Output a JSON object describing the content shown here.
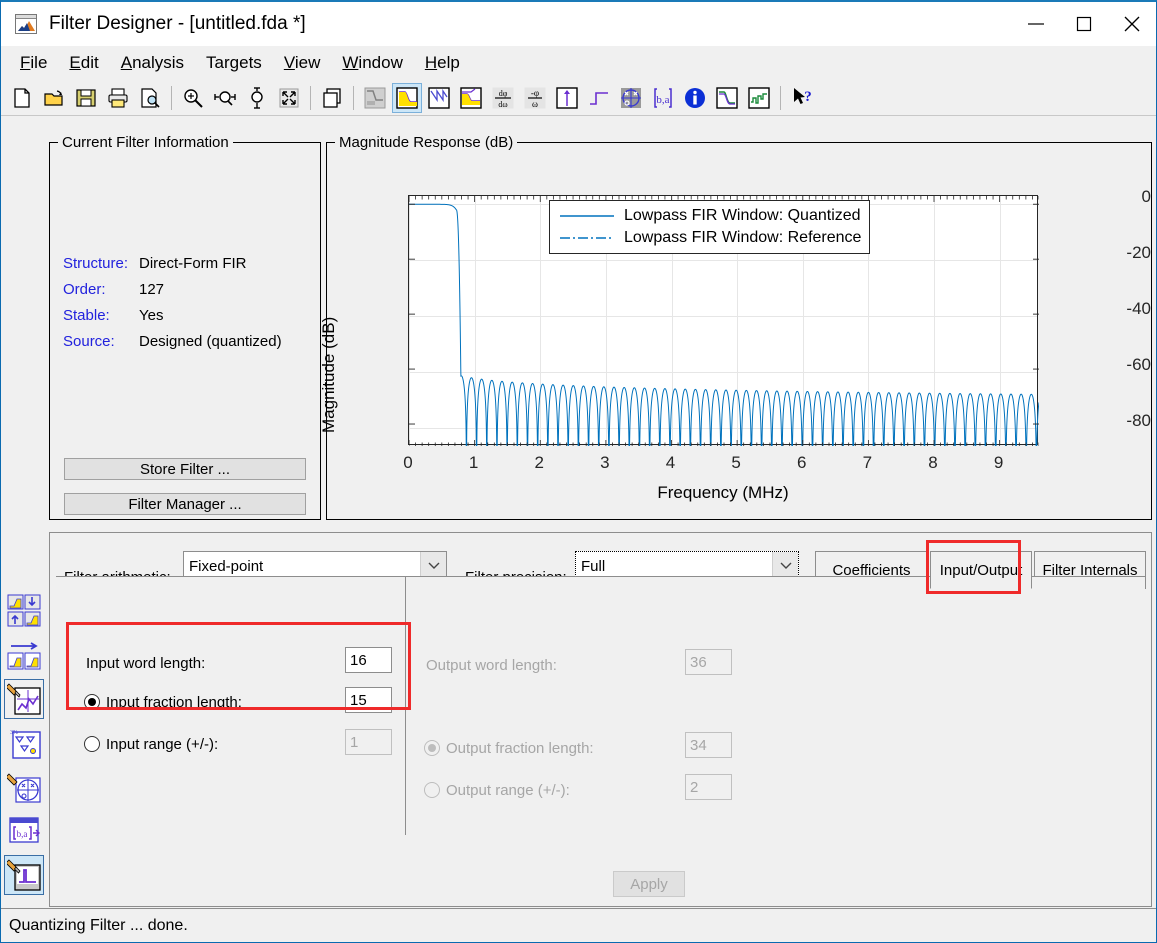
{
  "window": {
    "title": "Filter Designer -  [untitled.fda *]",
    "app_icon": "matlab-filter-icon",
    "minimize": "minimize-icon",
    "maximize": "maximize-icon",
    "close": "close-icon"
  },
  "menu": [
    {
      "label": "File",
      "mnemonic": "F"
    },
    {
      "label": "Edit",
      "mnemonic": "E"
    },
    {
      "label": "Analysis",
      "mnemonic": "A"
    },
    {
      "label": "Targets",
      "mnemonic": "g"
    },
    {
      "label": "View",
      "mnemonic": "V"
    },
    {
      "label": "Window",
      "mnemonic": "W"
    },
    {
      "label": "Help",
      "mnemonic": "H"
    }
  ],
  "toolbar": [
    {
      "name": "new-file-icon",
      "group": 0
    },
    {
      "name": "open-file-icon",
      "group": 0
    },
    {
      "name": "save-icon",
      "group": 0
    },
    {
      "name": "print-icon",
      "group": 0
    },
    {
      "name": "print-preview-icon",
      "group": 0
    },
    {
      "name": "zoom-in-icon",
      "group": 1
    },
    {
      "name": "zoom-x-icon",
      "group": 1
    },
    {
      "name": "zoom-y-icon",
      "group": 1
    },
    {
      "name": "full-view-icon",
      "group": 1
    },
    {
      "name": "copy-figure-icon",
      "group": 2
    },
    {
      "name": "filter-specifications-icon",
      "group": 3
    },
    {
      "name": "magnitude-response-icon",
      "group": 3,
      "selected": true
    },
    {
      "name": "phase-response-icon",
      "group": 3
    },
    {
      "name": "magnitude-phase-icon",
      "group": 3
    },
    {
      "name": "group-delay-icon",
      "group": 3
    },
    {
      "name": "phase-delay-icon",
      "group": 3
    },
    {
      "name": "impulse-response-icon",
      "group": 3
    },
    {
      "name": "step-response-icon",
      "group": 3
    },
    {
      "name": "pole-zero-plot-icon",
      "group": 3
    },
    {
      "name": "filter-coefficients-icon",
      "group": 3
    },
    {
      "name": "filter-information-icon",
      "group": 3
    },
    {
      "name": "magnitude-response-estimate-icon",
      "group": 3
    },
    {
      "name": "round-off-noise-power-icon",
      "group": 3
    },
    {
      "name": "context-help-icon",
      "group": 4
    }
  ],
  "sidebar": [
    {
      "name": "design-filter-icon",
      "label": "Design Filter"
    },
    {
      "name": "import-filter-icon",
      "label": "Import Filter"
    },
    {
      "name": "quantize-filter-icon",
      "label": "Set Quantization Parameters",
      "selected": false
    },
    {
      "name": "transform-filter-icon",
      "label": "Transform Filter"
    },
    {
      "name": "pole-zero-editor-icon",
      "label": "Pole/Zero Editor"
    },
    {
      "name": "realize-model-icon",
      "label": "Realize Model"
    },
    {
      "name": "set-quantization-parameters-icon",
      "label": "Set Quantization Parameters",
      "selected": true
    }
  ],
  "current_filter_information": {
    "title": "Current Filter Information",
    "rows": [
      {
        "key": "Structure:",
        "value": "Direct-Form FIR"
      },
      {
        "key": "Order:",
        "value": "127"
      },
      {
        "key": "Stable:",
        "value": "Yes"
      },
      {
        "key": "Source:",
        "value": "Designed (quantized)"
      }
    ],
    "store_filter_label": "Store Filter ...",
    "filter_manager_label": "Filter Manager ..."
  },
  "plot_panel": {
    "title": "Magnitude Response (dB)"
  },
  "chart_data": {
    "type": "line",
    "title": "Magnitude Response (dB)",
    "xlabel": "Frequency (MHz)",
    "ylabel": "Magnitude (dB)",
    "xlim": [
      0,
      9.6
    ],
    "ylim": [
      -88,
      3
    ],
    "xticks": [
      0,
      1,
      2,
      3,
      4,
      5,
      6,
      7,
      8,
      9
    ],
    "yticks": [
      0,
      -20,
      -40,
      -60,
      -80
    ],
    "xtick_labels": [
      "0",
      "1",
      "2",
      "3",
      "4",
      "5",
      "6",
      "7",
      "8",
      "9"
    ],
    "ytick_labels": [
      "0",
      "-20",
      "-40",
      "-60",
      "-80"
    ],
    "grid": true,
    "legend_position": "top-center",
    "series": [
      {
        "name": "Lowpass FIR Window: Quantized",
        "color": "#0072BD",
        "style": "solid",
        "description": "Lowpass FIR magnitude response: flat 0 dB passband to ~0.72 MHz, steep rolloff through -80 dB near 0.88 MHz, then stopband ripple lobes oscillating between about -62 dB and -88 dB, slowly decaying across the band.",
        "passband_edge_mhz": 0.72,
        "stopband_edge_mhz": 0.9,
        "passband_level_db": 0,
        "stopband_peak_db": -62,
        "stopband_floor_db": -88
      },
      {
        "name": "Lowpass FIR Window: Reference",
        "color": "#0072BD",
        "style": "dash-dot",
        "description": "Ideal (unquantized) reference response, overlapping the quantized trace in the passband."
      }
    ]
  },
  "design_panel": {
    "filter_arithmetic_label": "Filter arithmetic:",
    "filter_arithmetic_value": "Fixed-point",
    "filter_precision_label": "Filter precision:",
    "filter_precision_value": "Full",
    "tabs": [
      {
        "label": "Coefficients",
        "active": false
      },
      {
        "label": "Input/Output",
        "active": true,
        "highlighted": true
      },
      {
        "label": "Filter Internals",
        "active": false
      }
    ],
    "input_group": {
      "word_length_label": "Input word length:",
      "word_length_value": "16",
      "fraction_length_label": "Input fraction length:",
      "fraction_length_value": "15",
      "fraction_length_selected": true,
      "range_label": "Input range (+/-):",
      "range_value": "1",
      "range_selected": false
    },
    "output_group": {
      "word_length_label": "Output word length:",
      "word_length_value": "36",
      "fraction_length_label": "Output fraction length:",
      "fraction_length_value": "34",
      "fraction_length_selected": true,
      "range_label": "Output range (+/-):",
      "range_value": "2",
      "range_selected": false,
      "disabled": true
    },
    "apply_label": "Apply"
  },
  "status_bar": {
    "message": "Quantizing Filter ... done."
  },
  "colors": {
    "plot_line": "#0072BD",
    "accent_blue": "#2222dd",
    "highlight_red": "#ef2a2a",
    "window_border": "#0a6ab0",
    "panel_bg": "#f0f0f0"
  }
}
